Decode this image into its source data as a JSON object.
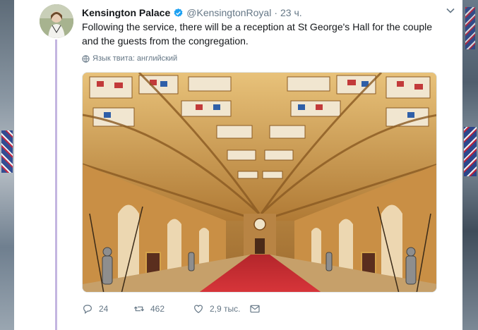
{
  "tweet": {
    "author_name": "Kensington Palace",
    "author_handle": "@KensingtonRoyal",
    "separator": "·",
    "timestamp": "23 ч.",
    "text": "Following the service, there will be a reception at St George's Hall for the couple and the guests from the congregation.",
    "language_note": "Язык твита: английский",
    "media_alt": "St George's Hall interior",
    "reply_count": "24",
    "retweet_count": "462",
    "like_count": "2,9 тыс."
  },
  "colors": {
    "thread_line": "#c4b5e0",
    "verified": "#1da1f2",
    "secondary_text": "#657786",
    "primary_text": "#14171a"
  },
  "icons": [
    "chevron-down-icon",
    "verified-badge-icon",
    "globe-icon",
    "reply-icon",
    "retweet-icon",
    "like-icon",
    "direct-message-icon"
  ]
}
